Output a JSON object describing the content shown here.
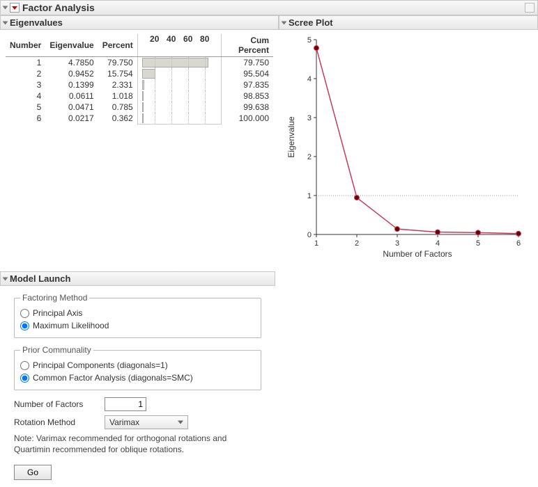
{
  "title": "Factor Analysis",
  "sections": {
    "eigenvalues": "Eigenvalues",
    "scree": "Scree Plot",
    "model": "Model Launch"
  },
  "table": {
    "headers": {
      "number": "Number",
      "eigen": "Eigenvalue",
      "percent": "Percent",
      "cum": "Cum Percent"
    },
    "bar_ticks": [
      "20",
      "40",
      "60",
      "80"
    ],
    "rows": [
      {
        "n": "1",
        "eigen": "4.7850",
        "pct": "79.750",
        "cum": "79.750"
      },
      {
        "n": "2",
        "eigen": "0.9452",
        "pct": "15.754",
        "cum": "95.504"
      },
      {
        "n": "3",
        "eigen": "0.1399",
        "pct": "2.331",
        "cum": "97.835"
      },
      {
        "n": "4",
        "eigen": "0.0611",
        "pct": "1.018",
        "cum": "98.853"
      },
      {
        "n": "5",
        "eigen": "0.0471",
        "pct": "0.785",
        "cum": "99.638"
      },
      {
        "n": "6",
        "eigen": "0.0217",
        "pct": "0.362",
        "cum": "100.000"
      }
    ]
  },
  "chart_data": {
    "type": "line",
    "title": "Scree Plot",
    "xlabel": "Number of Factors",
    "ylabel": "Eigenvalue",
    "x": [
      1,
      2,
      3,
      4,
      5,
      6
    ],
    "y": [
      4.785,
      0.9452,
      0.1399,
      0.0611,
      0.0471,
      0.0217
    ],
    "xlim": [
      1,
      6
    ],
    "ylim": [
      0,
      5
    ],
    "xticks": [
      1,
      2,
      3,
      4,
      5,
      6
    ],
    "yticks": [
      0,
      1,
      2,
      3,
      4,
      5
    ],
    "reference_lines_y": [
      0,
      1
    ]
  },
  "model": {
    "factoring": {
      "legend": "Factoring Method",
      "opt1": "Principal Axis",
      "opt2": "Maximum Likelihood",
      "selected": "Maximum Likelihood"
    },
    "prior": {
      "legend": "Prior Communality",
      "opt1": "Principal Components (diagonals=1)",
      "opt2": "Common Factor Analysis (diagonals=SMC)",
      "selected": "Common Factor Analysis (diagonals=SMC)"
    },
    "num_factors_label": "Number of Factors",
    "num_factors_value": "1",
    "rotation_label": "Rotation Method",
    "rotation_value": "Varimax",
    "note": "Note: Varimax recommended for orthogonal rotations and Quartimin recommended for oblique rotations.",
    "go": "Go"
  }
}
